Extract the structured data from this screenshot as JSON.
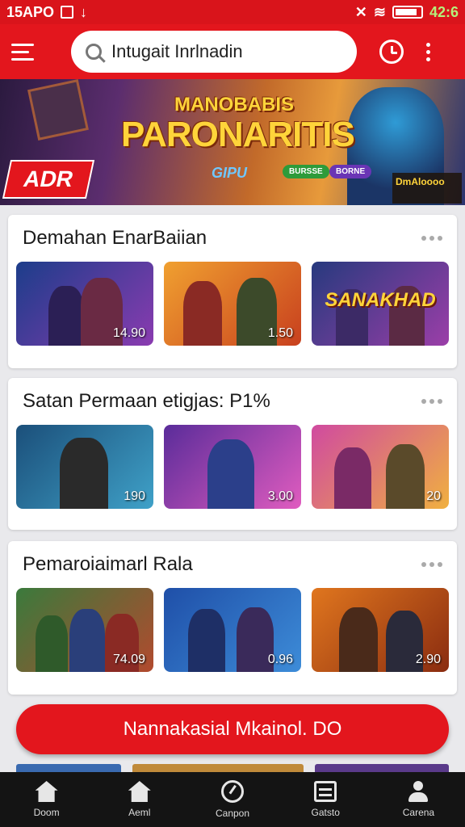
{
  "status_bar": {
    "left_text": "15APO",
    "time": "42:6"
  },
  "search": {
    "placeholder": "Intugait Inrlnadin"
  },
  "banner": {
    "subtitle": "MANOBABIS",
    "title": "PARONARITIS",
    "tagline": "GIPU",
    "badge": "ADR",
    "pill_a": "BURSSE",
    "pill_b": "BORNE",
    "corner_text": "DmAloooo"
  },
  "sections": [
    {
      "title": "Demahan EnarBaiian",
      "cards": [
        {
          "price": "14.90",
          "label": "",
          "colors": [
            "#1c3d8a",
            "#8a3bb0"
          ]
        },
        {
          "price": "1.50",
          "label": "",
          "colors": [
            "#f0a030",
            "#c8401e"
          ]
        },
        {
          "price": "",
          "label": "SANAKHAD",
          "colors": [
            "#273a7e",
            "#9b3ea8"
          ]
        }
      ]
    },
    {
      "title": "Satan Permaan etigjas: P1%",
      "cards": [
        {
          "price": "190",
          "label": "",
          "colors": [
            "#1b4f7a",
            "#3fa1c8"
          ]
        },
        {
          "price": "3.00",
          "label": "",
          "colors": [
            "#5a2c9a",
            "#e05cbf"
          ]
        },
        {
          "price": "20",
          "label": "",
          "colors": [
            "#d04aa0",
            "#f0b040"
          ]
        }
      ]
    },
    {
      "title": "Pemaroiaimarl Rala",
      "cards": [
        {
          "price": "74.09",
          "label": "",
          "colors": [
            "#3a7a3c",
            "#b24a2e"
          ]
        },
        {
          "price": "0.96",
          "label": "",
          "colors": [
            "#1f4fa8",
            "#3d8cd8"
          ]
        },
        {
          "price": "2.90",
          "label": "",
          "colors": [
            "#e0761e",
            "#8a2c10"
          ]
        }
      ]
    }
  ],
  "cta_label": "Nannakasial Mkainol. DO",
  "nav": [
    {
      "label": "Doom",
      "icon": "home-icon"
    },
    {
      "label": "Aeml",
      "icon": "home-icon"
    },
    {
      "label": "Canpon",
      "icon": "globe-icon"
    },
    {
      "label": "Gatsto",
      "icon": "list-icon"
    },
    {
      "label": "Carena",
      "icon": "user-icon"
    }
  ]
}
